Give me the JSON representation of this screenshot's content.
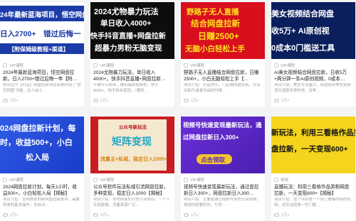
{
  "cards": [
    {
      "lines": [
        "24年最新蓝海项目，悟空网盘",
        "日入2700+　错过后悔一",
        "【附保姆级教程+渠道】"
      ],
      "category": "VIP课程",
      "title": "2024年最新蓝海项目，悟空网盘拉新，日入2700+错过后悔一年【附…",
      "desc": "本项目为【抖音】网盘拉新项目就是利用了“悟空网盘”功能，达人由上…",
      "views": "1万+"
    },
    {
      "lines": [
        "2024尤物暴力玩法",
        "单日收入4000+",
        "快手抖音直播+网盘拉新",
        "超暴力男粉无脑变现"
      ],
      "category": "VIP课程",
      "title": "2024尤物暴力玩法，单日收入4000+，快手抖音直播+网盘拉新…",
      "desc": "不要什么粉丝，做出爆款视频把，快手6000+，快手粉丝变现，（模仿…",
      "views": "1万+"
    },
    {
      "lines": [
        "野路子无人直播",
        "结合网盘拉新",
        "日赚2500+",
        "无脑小白轻松上手"
      ],
      "category": "VIP课程",
      "title": "野路子无人直播结合网盘拉新，日赚2500+，小白无脑轻松上手【…",
      "desc": "项目介绍：抖音快手，一起做网盘拉新，分享出影片或者作品的时候…",
      "views": "1万+"
    },
    {
      "lines": [
        "美女视频结合网盘",
        "收5万+ AI原创视",
        "0成本0门槛送工具"
      ],
      "category": "VIP课程",
      "title": "AI美女视频结合网盘拉新，日收5万+两分钟一条AI原创视频，0成本…",
      "desc": "项目介绍：美女号流量大，网盘结合美女视频增长速度非常的快，这种…",
      "views": "1万+"
    },
    {
      "lines": [
        "024网盘拉新计划，每",
        "时，收益500+，小白",
        "松入局"
      ],
      "category": "VIP课程",
      "title": "2024网盘拉新计划，每天1小时，收益500+，小白轻松入局【揭秘】",
      "desc": "项目介绍：全网首发的新网盘拉新技术，需要简单的基本操作，全自动…",
      "views": "1万+"
    },
    {
      "lines": [
        "公众号新玩法",
        "矩阵变现",
        "流量主+私域，稳定日入1000+"
      ],
      "category": "VIP课程",
      "title": "公众号软件玩法私域引流网盘拉新，多种变现，稳定日入1000【揭秘】",
      "desc": "项目介绍：本地商家的日常引流项目，一个人天就能做，流量来源广泛…",
      "views": "1万+"
    },
    {
      "lines": [
        "视频号快速变现最新玩法，通",
        "过网盘拉新日入300+",
        "点击领取"
      ],
      "category": "VIP课程",
      "title": "视频号快速变现最新玩法，通过盘拉新日入300+，网盘拉新日入300…",
      "desc": "项目介绍：主要是通过视频号发布分享视频，视频内容要好的，引导…",
      "views": "1万+"
    },
    {
      "lines": [
        "新玩法，利用三看格作品男",
        "盘拉新，一天变现600+"
      ],
      "category": "视频",
      "title": "直播玩法：利用三看格作品男粉网盘拉新，一天变现600+【揭秘】",
      "desc": "项目介绍：这个项目是一个用三看格内容的视频，说实话就是一些门槛…",
      "views": "1万+"
    }
  ]
}
